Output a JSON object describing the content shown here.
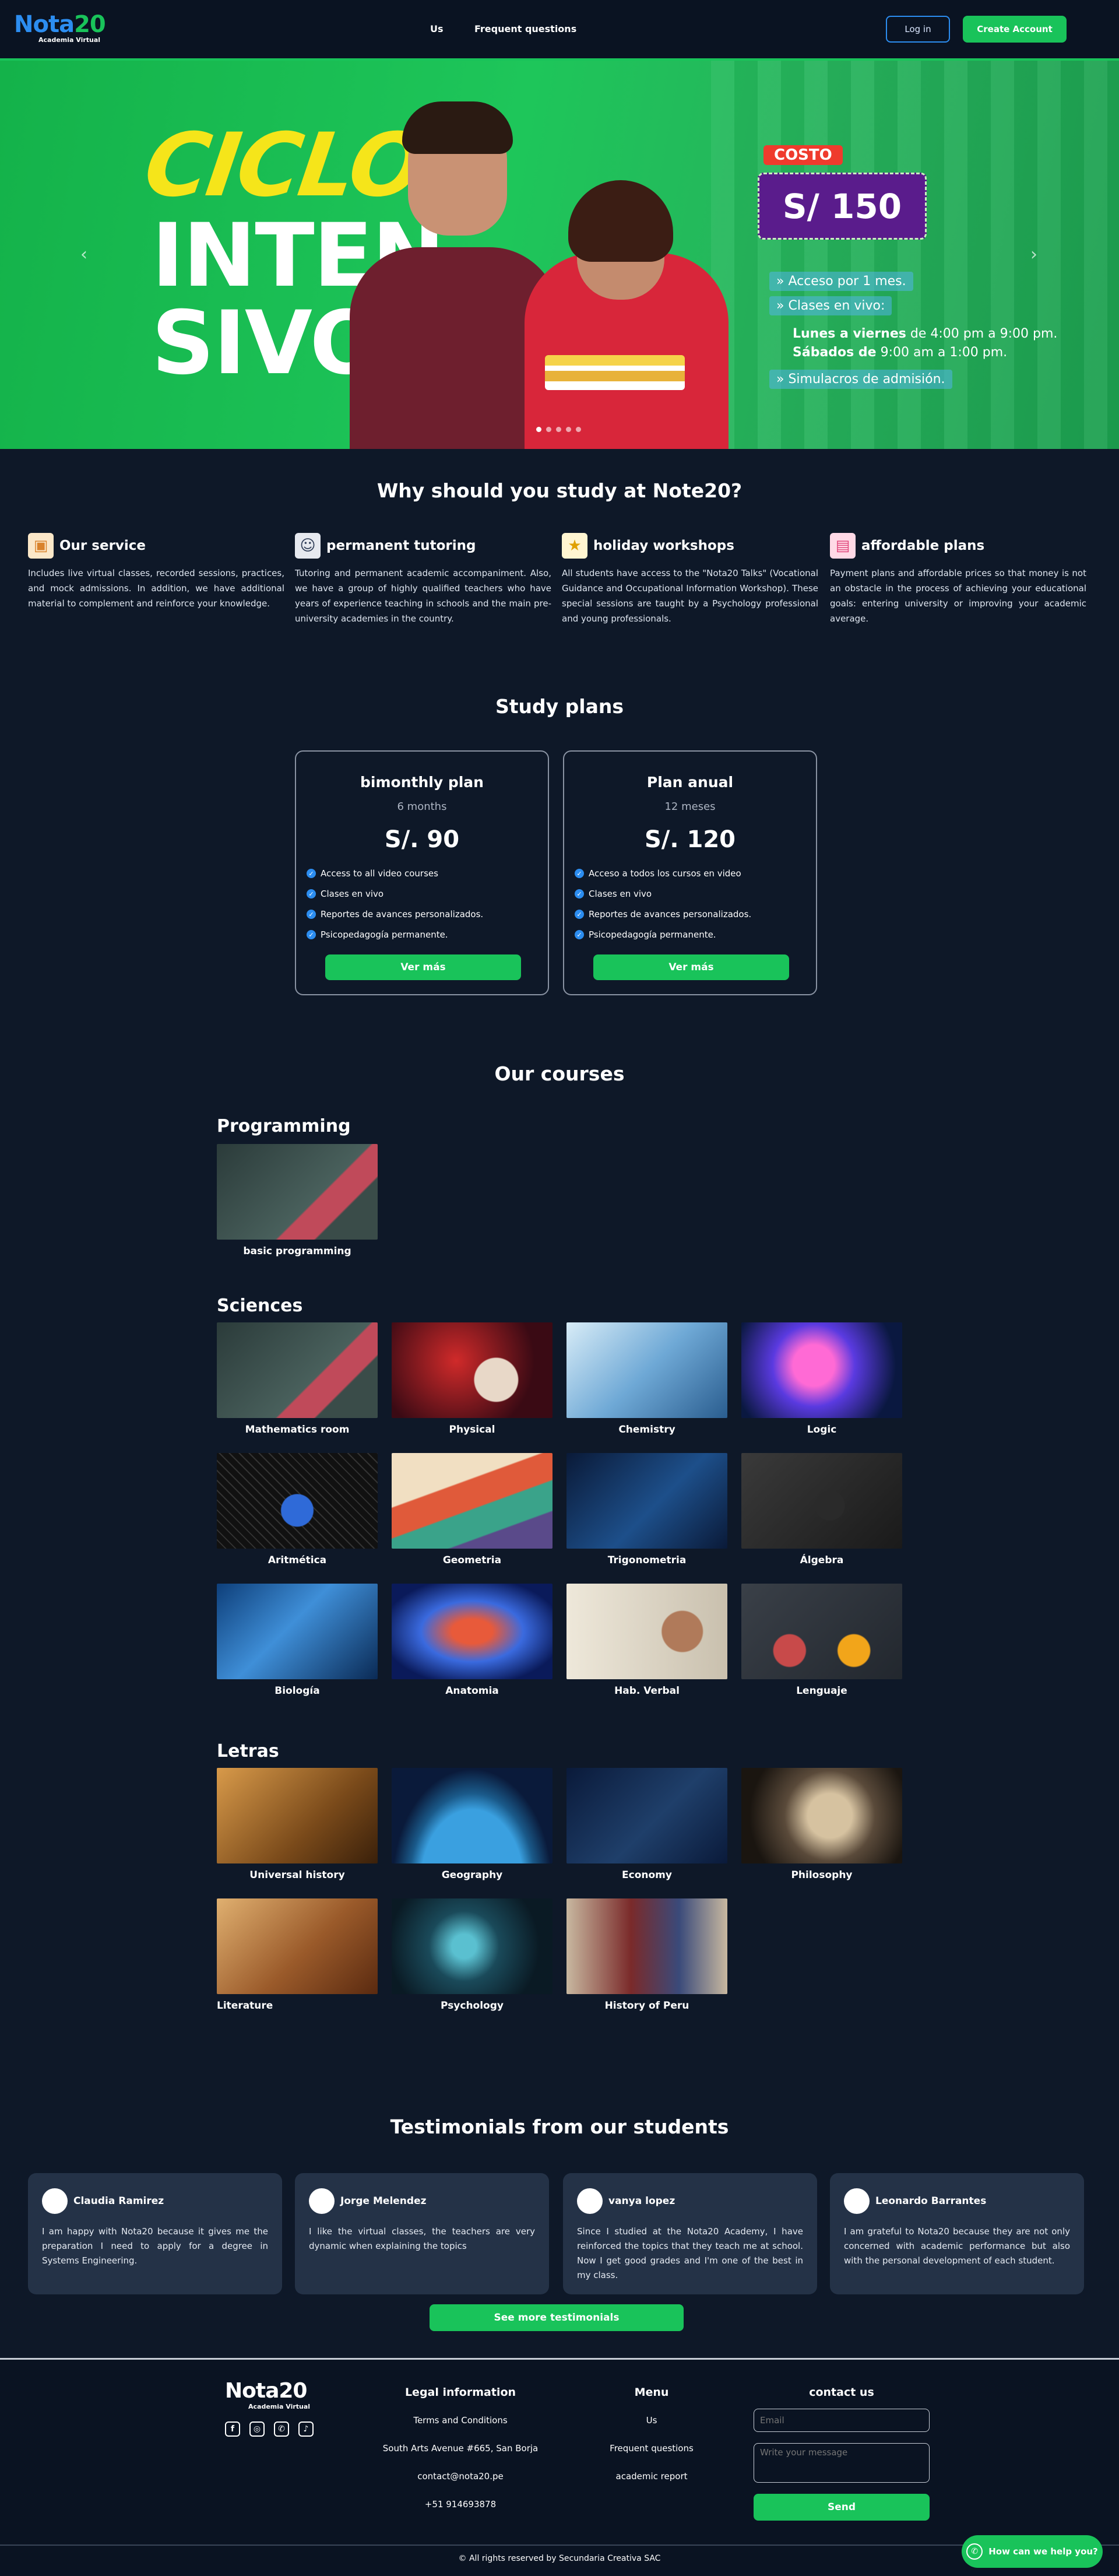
{
  "nav": {
    "logo_main_a": "Nota",
    "logo_main_b": "20",
    "logo_sub": "Academia Virtual",
    "links": [
      "Us",
      "Frequent questions"
    ],
    "login_label": "Log in",
    "create_label": "Create Account"
  },
  "hero": {
    "ciclo": "CICLO",
    "inten": "INTEN",
    "sivo": "SIVO",
    "costo": "COSTO",
    "price": "S/ 150",
    "line1": "Acceso por 1 mes.",
    "line2": "Clases en vivo:",
    "line3_bold": "Lunes a viernes",
    "line3_rest": " de 4:00 pm a 9:00 pm.",
    "line4_bold": "Sábados de",
    "line4_rest": " 9:00 am a 1:00 pm.",
    "line5": "Simulacros de admisión."
  },
  "why": {
    "title": "Why should you study at Note20?",
    "features": [
      {
        "title": "Our service",
        "text": "Includes live virtual classes, recorded sessions, practices, and mock admissions. In addition, we have additional material to complement and reinforce your knowledge."
      },
      {
        "title": "permanent tutoring",
        "text": "Tutoring and permanent academic accompaniment. Also, we have a group of highly qualified teachers who have years of experience teaching in schools and the main pre-university academies in the country."
      },
      {
        "title": "holiday workshops",
        "text": "All students have access to the \"Nota20 Talks\" (Vocational Guidance and Occupational Information Workshop). These special sessions are taught by a Psychology professional and young professionals."
      },
      {
        "title": "affordable plans",
        "text": "Payment plans and affordable prices so that money is not an obstacle in the process of achieving your educational goals: entering university or improving your academic average."
      }
    ]
  },
  "plans": {
    "title": "Study plans",
    "items": [
      {
        "name": "bimonthly plan",
        "duration": "6 months",
        "price": "S/. 90",
        "features": [
          "Access to all video courses",
          "Clases en vivo",
          "Reportes de avances personalizados.",
          "Psicopedagogía permanente."
        ],
        "button": "Ver más"
      },
      {
        "name": "Plan anual",
        "duration": "12 meses",
        "price": "S/. 120",
        "features": [
          "Acceso a todos los cursos en video",
          "Clases en vivo",
          "Reportes de avances personalizados.",
          "Psicopedagogía permanente."
        ],
        "button": "Ver más"
      }
    ]
  },
  "courses": {
    "title": "Our courses",
    "categories": [
      {
        "name": "Programming",
        "items": [
          "basic programming"
        ]
      },
      {
        "name": "Sciences",
        "items": [
          "Mathematics room",
          "Physical",
          "Chemistry",
          "Logic",
          "Aritmética",
          "Geometria",
          "Trigonometria",
          "Álgebra",
          "Biología",
          "Anatomia",
          "Hab. Verbal",
          "Lenguaje"
        ]
      },
      {
        "name": "Letras",
        "items": [
          "Universal history",
          "Geography",
          "Economy",
          "Philosophy",
          "Literature",
          "Psychology",
          "History of Peru"
        ]
      }
    ]
  },
  "testimonials": {
    "title": "Testimonials from our students",
    "items": [
      {
        "name": "Claudia Ramirez",
        "text": "I am happy with Nota20 because it gives me the preparation I need to apply for a degree in Systems Engineering."
      },
      {
        "name": "Jorge Melendez",
        "text": "I like the virtual classes, the teachers are very dynamic when explaining the topics"
      },
      {
        "name": "vanya lopez",
        "text": "Since I studied at the Nota20 Academy, I have reinforced the topics that they teach me at school. Now I get good grades and I'm one of the best in my class."
      },
      {
        "name": "Leonardo Barrantes",
        "text": "I am grateful to Nota20 because they are not only concerned with academic performance but also with the personal development of each student."
      }
    ],
    "more_button": "See more testimonials"
  },
  "footer": {
    "logo_main": "Nota20",
    "logo_sub": "Academia Virtual",
    "legal_title": "Legal information",
    "legal_items": [
      "Terms and Conditions",
      "South Arts Avenue #665, San Borja",
      "contact@nota20.pe",
      "+51 914693878"
    ],
    "menu_title": "Menu",
    "menu_items": [
      "Us",
      "Frequent questions",
      "academic report"
    ],
    "contact_title": "contact us",
    "email_placeholder": "Email",
    "message_placeholder": "Write your message",
    "send_label": "Send",
    "copyright": "© All rights reserved by Secundaria Creativa SAC",
    "whatsapp_label": "How can we help you?"
  }
}
